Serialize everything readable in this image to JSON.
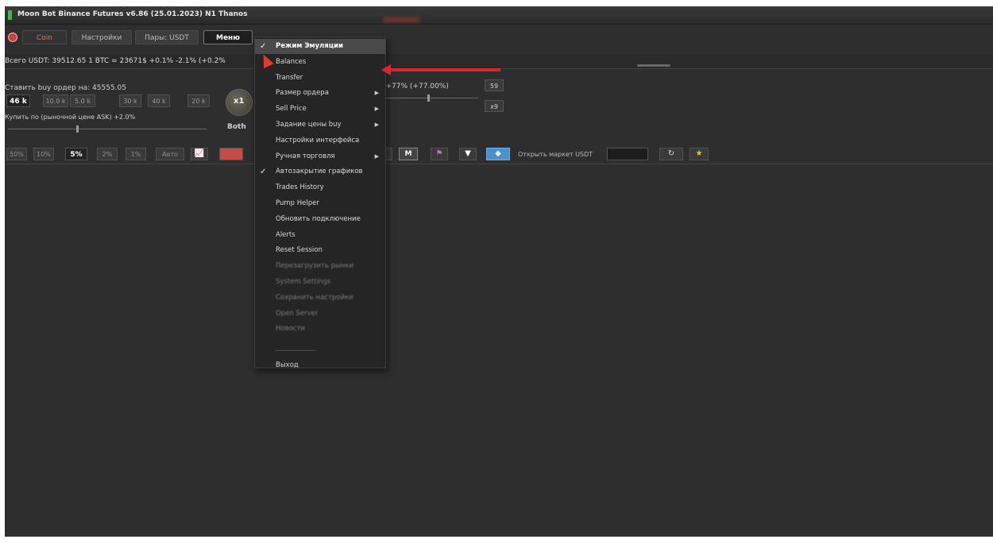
{
  "window": {
    "title": "Moon Bot Binance Futures v6.86 (25.01.2023) N1  Thanos"
  },
  "toolbar": {
    "coin_tab": "Coin",
    "settings_tab": "Настройки",
    "pairs_tab": "Пары: USDT",
    "menu_tab": "Меню",
    "menu_chevron": "▼"
  },
  "info": {
    "balance": "Всего USDT: 39512.65    1 BTC = 23671$  +0.1% -2.1% (+0.2%"
  },
  "order": {
    "buy_order_label": "Ставить buy ордер на: 45555.05",
    "quantities": [
      "46 k",
      "10.0 k",
      "5.0 k",
      "30 k",
      "40 k",
      "20 k"
    ],
    "multiplier": "x1",
    "buy_price_label": "Купить по (рыночной цене ASK) +2.0%",
    "both_label": "Both",
    "percent_readout": "(+77% (+77.00%)",
    "side_values": [
      "59",
      "x9"
    ]
  },
  "percent_buttons": [
    "50%",
    "10%",
    "5%",
    "2%",
    "1%",
    "Авто"
  ],
  "toolbar2": {
    "m_label": "M",
    "open_market_label": "Открыть маркет USDT",
    "market_input_value": ""
  },
  "icons": {
    "chart": "📈",
    "flag": "⚑",
    "filter": "▼",
    "blue": "◆",
    "refresh": "↻",
    "star": "★",
    "check": "✓",
    "arrow": "▶"
  },
  "colors": {
    "accent_red": "#e4202a",
    "tab_coin": "#ff6a3d",
    "star": "#f2c12e",
    "background": "#2e2e2e"
  },
  "menu": {
    "items": [
      {
        "label": "Режим Эмуляции",
        "checked": true,
        "highlighted": true
      },
      {
        "label": "Balances"
      },
      {
        "label": "Transfer"
      },
      {
        "label": "Размер ордера",
        "submenu": true
      },
      {
        "label": "Sell Price",
        "submenu": true
      },
      {
        "label": "Задание цены buy",
        "submenu": true
      },
      {
        "label": "Настройки интерфейса"
      },
      {
        "label": "Ручная торговля",
        "submenu": true
      },
      {
        "label": "Автозакрытие графиков",
        "checked": true
      },
      {
        "label": "Trades History"
      },
      {
        "label": "Pump Helper"
      },
      {
        "label": "Обновить подключение"
      },
      {
        "label": "Alerts"
      },
      {
        "label": "Reset Session"
      },
      {
        "label": "Перезагрузить рынки",
        "blurred": true
      },
      {
        "label": "System Settings",
        "blurred": true
      },
      {
        "label": "Сохранить настройки",
        "blurred": true
      },
      {
        "label": "Open Server",
        "blurred": true
      },
      {
        "label": "Новости",
        "blurred": true
      }
    ],
    "exit": "Выход"
  }
}
